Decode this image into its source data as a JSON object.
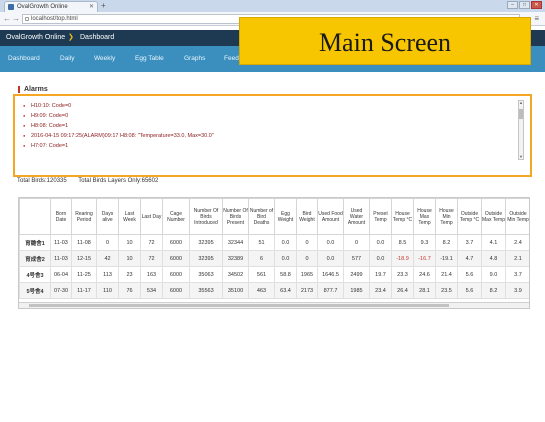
{
  "browser": {
    "tab_title": "OvalGrowth Online",
    "url": "localhost/top.html"
  },
  "app": {
    "name": "OvalGrowth Online",
    "breadcrumb": "Dashboard"
  },
  "nav": [
    "Dashboard",
    "Daily",
    "Weekly",
    "Egg Table",
    "Graphs",
    "Feed"
  ],
  "banner": "Main Screen",
  "alarms": {
    "title": "Alarms",
    "items": [
      "H10:10: Code=0",
      "H9:09: Code=0",
      "H8:08: Code=1",
      "2016-04-15 09:17:25(ALARM)09:17 H8:08: \"Temperature=33.0, Max=30.0\"",
      "H7:07: Code=1"
    ]
  },
  "totals": {
    "birds": "Total Birds:120335",
    "layers": "Total Birds Layers Only:65602"
  },
  "table": {
    "headers": [
      "",
      "Born Date",
      "Rearing Period",
      "Days alive",
      "Last Week",
      "Last Day",
      "Cage Number",
      "Number Of Birds Introduced",
      "Number Of Birds Present",
      "Number of Bird Deaths",
      "Egg Weight",
      "Bird Weight",
      "Used Food Amount",
      "Used Water Amount",
      "Preset Temp",
      "House Temp °C",
      "House Max Temp",
      "House Min Temp",
      "Outside Temp °C",
      "Outside Max Temp",
      "Outside Min Temp"
    ],
    "rows": [
      [
        "育雛舎1",
        "11-03",
        "11-08",
        "0",
        "10",
        "72",
        "6000",
        "32395",
        "32344",
        "51",
        "0.0",
        "0",
        "0.0",
        "0",
        "0.0",
        "8.5",
        "9.3",
        "8.2",
        "3.7",
        "4.1",
        "2.4"
      ],
      [
        "育成舎2",
        "11-03",
        "12-15",
        "42",
        "10",
        "72",
        "6000",
        "32395",
        "32389",
        "6",
        "0.0",
        "0",
        "0.0",
        "577",
        "0.0",
        "-18.9",
        "-16.7",
        "-19.1",
        "4.7",
        "4.8",
        "2.1"
      ],
      [
        "4号舎3",
        "06-04",
        "11-25",
        "113",
        "23",
        "163",
        "6000",
        "35063",
        "34502",
        "561",
        "58.8",
        "1965",
        "1646.5",
        "2499",
        "19.7",
        "23.3",
        "24.6",
        "21.4",
        "5.6",
        "9.0",
        "3.7"
      ],
      [
        "5号舎4",
        "07-30",
        "11-17",
        "110",
        "76",
        "534",
        "6000",
        "35563",
        "35100",
        "463",
        "63.4",
        "2173",
        "877.7",
        "1985",
        "23.4",
        "26.4",
        "28.1",
        "23.5",
        "5.6",
        "8.2",
        "3.9"
      ]
    ],
    "red_cells": [
      [
        1,
        15
      ],
      [
        1,
        16
      ]
    ]
  }
}
